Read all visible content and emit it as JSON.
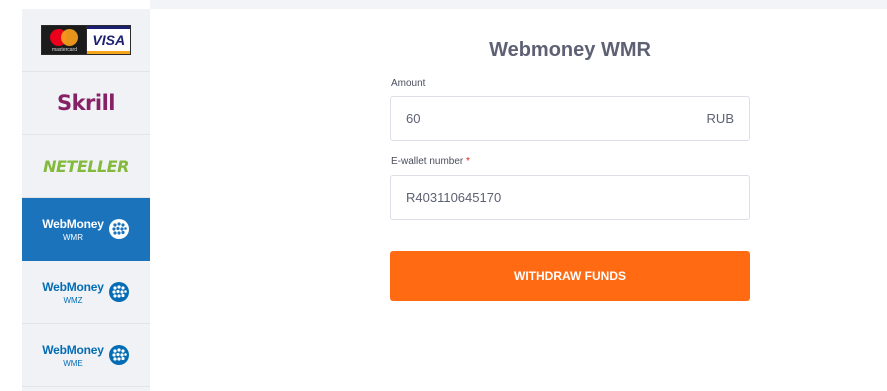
{
  "payment_methods": [
    {
      "id": "card",
      "label_mc": "mastercard",
      "label_visa": "VISA",
      "active": false
    },
    {
      "id": "skrill",
      "label": "Skrill",
      "active": false
    },
    {
      "id": "neteller",
      "label": "NETELLER",
      "active": false
    },
    {
      "id": "wmr",
      "name": "WebMoney",
      "currency": "WMR",
      "active": true
    },
    {
      "id": "wmz",
      "name": "WebMoney",
      "currency": "WMZ",
      "active": false
    },
    {
      "id": "wme",
      "name": "WebMoney",
      "currency": "WME",
      "active": false
    }
  ],
  "form": {
    "title": "Webmoney WMR",
    "amount_label": "Amount",
    "amount_value": "60",
    "amount_currency": "RUB",
    "wallet_label": "E-wallet number",
    "wallet_required_mark": "*",
    "wallet_value": "R403110645170",
    "submit_label": "WITHDRAW FUNDS"
  },
  "colors": {
    "active_method_bg": "#1a73bb",
    "button_bg": "#ff6a13",
    "webmoney_blue": "#036cb5",
    "skrill_purple": "#862165",
    "neteller_green": "#83ba3b"
  }
}
